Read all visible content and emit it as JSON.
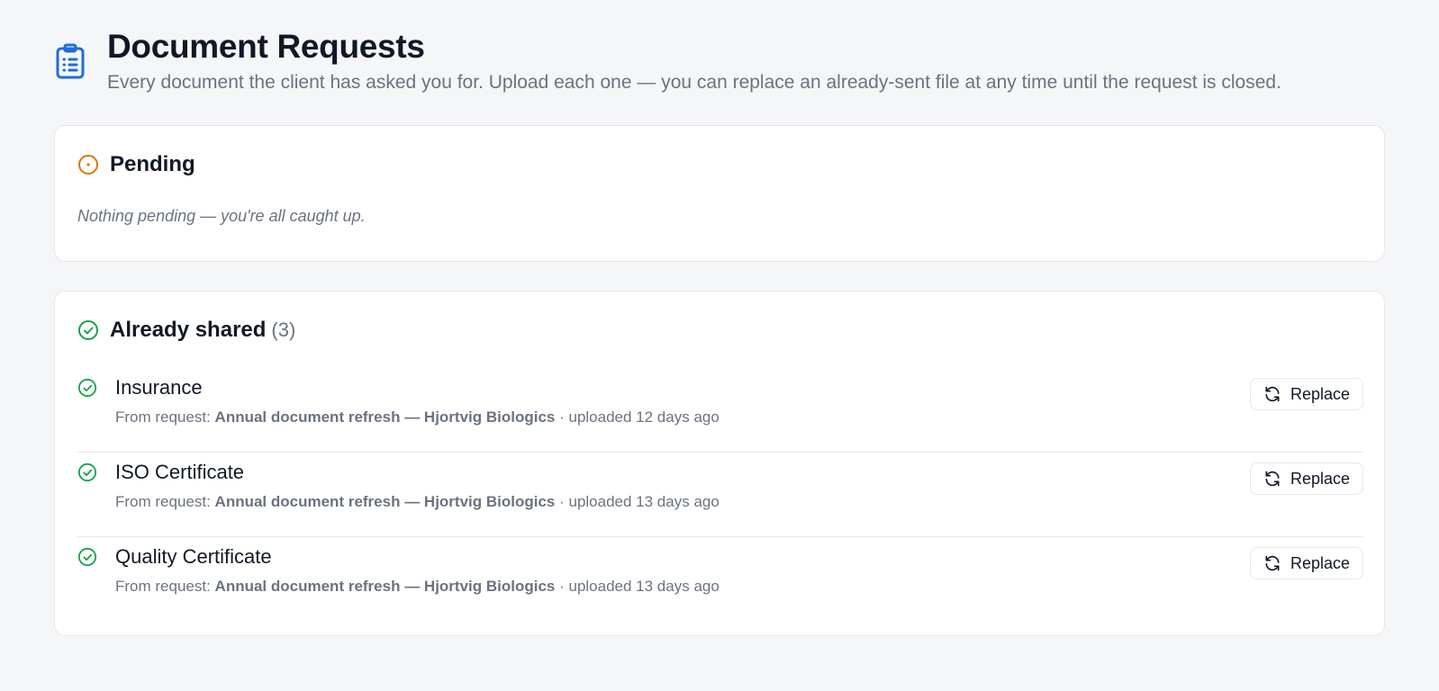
{
  "header": {
    "title": "Document Requests",
    "subtitle": "Every document the client has asked you for. Upload each one — you can replace an already-sent file at any time until the request is closed.",
    "icon": "clipboard-icon"
  },
  "pending": {
    "title": "Pending",
    "empty_text": "Nothing pending — you're all caught up.",
    "icon": "pending-circle-icon",
    "color": "#d97706"
  },
  "shared": {
    "title": "Already shared",
    "count": "(3)",
    "icon": "check-circle-icon",
    "color": "#16a34a",
    "items": [
      {
        "name": "Insurance",
        "from_label": "From request:",
        "request": "Annual document refresh — Hjortvig Biologics",
        "uploaded": "· uploaded 12 days ago",
        "action": "Replace"
      },
      {
        "name": "ISO Certificate",
        "from_label": "From request:",
        "request": "Annual document refresh — Hjortvig Biologics",
        "uploaded": "· uploaded 13 days ago",
        "action": "Replace"
      },
      {
        "name": "Quality Certificate",
        "from_label": "From request:",
        "request": "Annual document refresh — Hjortvig Biologics",
        "uploaded": "· uploaded 13 days ago",
        "action": "Replace"
      }
    ]
  },
  "colors": {
    "accent_blue": "#1d6fd6",
    "text_primary": "#111827",
    "text_muted": "#6b7280"
  }
}
